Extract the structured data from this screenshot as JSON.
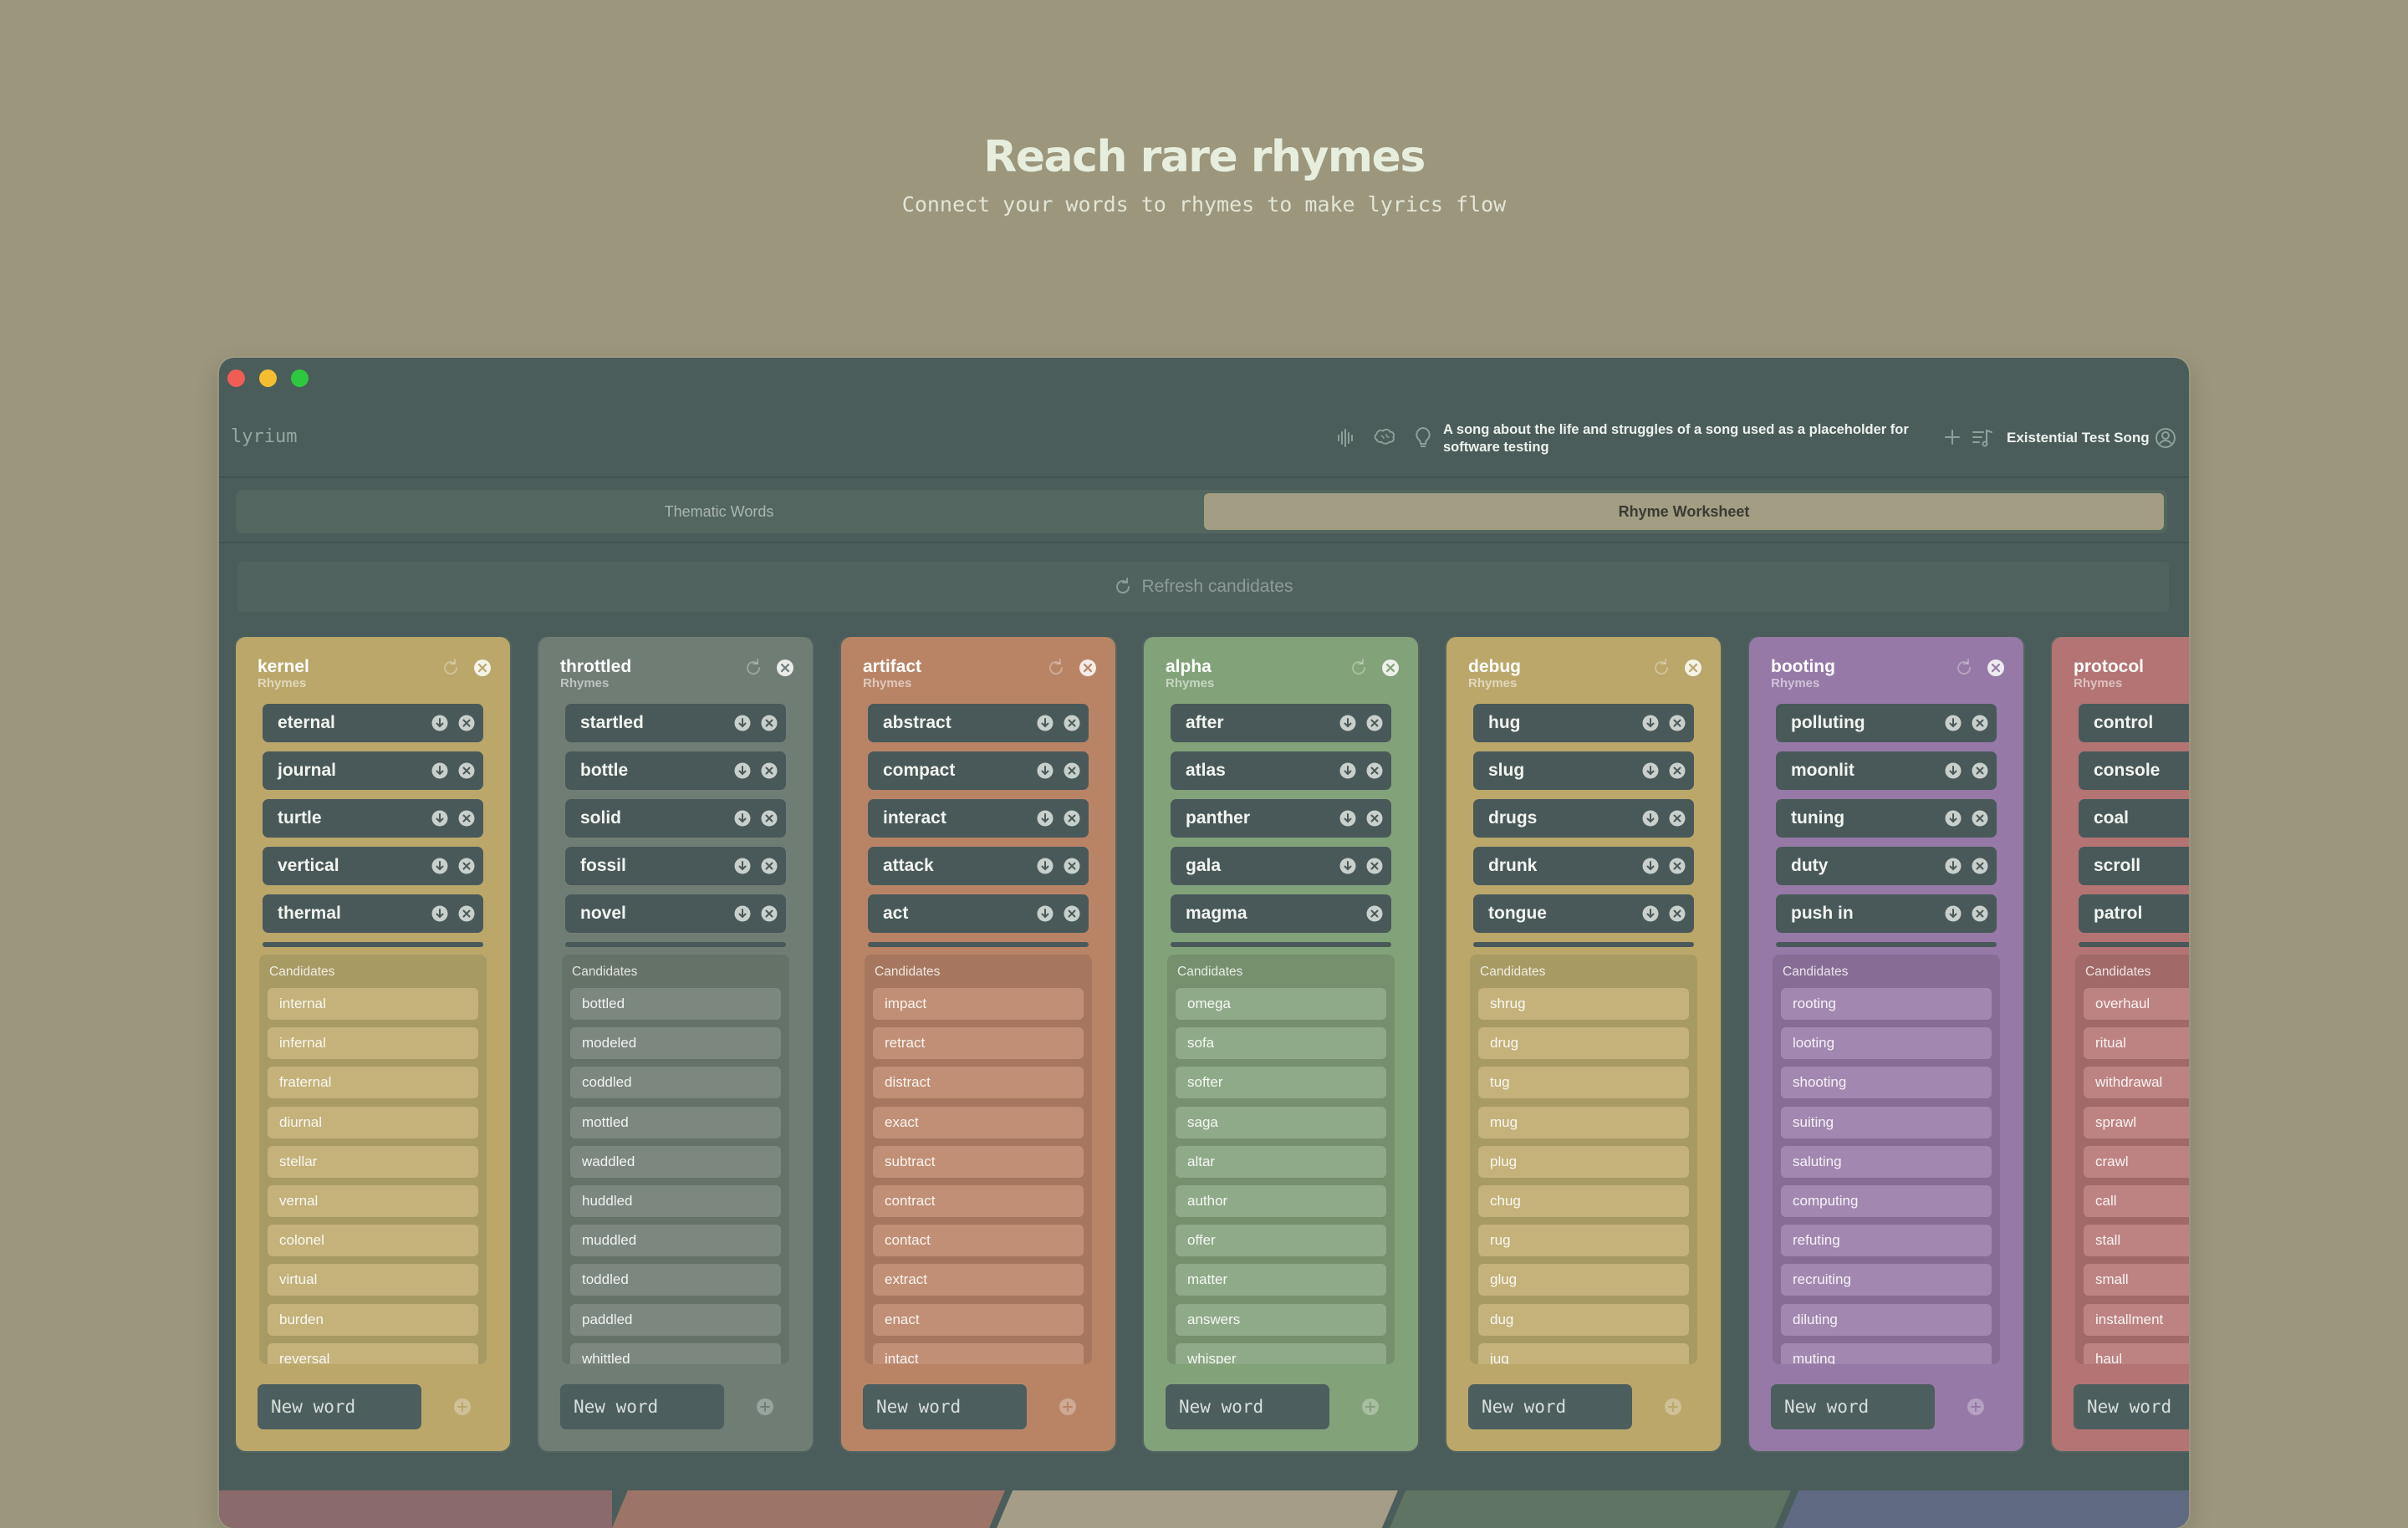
{
  "hero": {
    "title": "Reach rare rhymes",
    "subtitle": "Connect your words to rhymes to make lyrics flow"
  },
  "app": {
    "logo": "lyrium",
    "header_icons": [
      "waveform-icon",
      "brain-icon",
      "lightbulb-icon"
    ],
    "song_description": "A song about the life and struggles of a song used as a placeholder for software testing",
    "song_title": "Existential Test Song"
  },
  "tabs": [
    {
      "label": "Thematic Words",
      "active": false
    },
    {
      "label": "Rhyme Worksheet",
      "active": true
    }
  ],
  "refresh_label": "Refresh candidates",
  "new_word_placeholder": "New word",
  "colors": {
    "kernel": "#bba76a",
    "throttled": "#6f7d75",
    "artifact": "#b98466",
    "alpha": "#82a279",
    "debug": "#bba76a",
    "booting": "#9679a6",
    "protocol": "#b37473"
  },
  "columns": [
    {
      "key": "kernel",
      "title": "kernel",
      "subtitle": "Rhymes",
      "bg": "#bba76a",
      "panel": "#a89a63",
      "cand_bg": "#c4b27a",
      "rhymes": [
        "eternal",
        "journal",
        "turtle",
        "vertical",
        "thermal"
      ],
      "candidates": [
        "internal",
        "infernal",
        "fraternal",
        "diurnal",
        "stellar",
        "vernal",
        "colonel",
        "virtual",
        "burden",
        "reversal"
      ]
    },
    {
      "key": "throttled",
      "title": "throttled",
      "subtitle": "Rhymes",
      "bg": "#6f7d75",
      "panel": "#657268",
      "cand_bg": "#7b877f",
      "rhymes": [
        "startled",
        "bottle",
        "solid",
        "fossil",
        "novel"
      ],
      "candidates": [
        "bottled",
        "modeled",
        "coddled",
        "mottled",
        "waddled",
        "huddled",
        "muddled",
        "toddled",
        "paddled",
        "whittled"
      ]
    },
    {
      "key": "artifact",
      "title": "artifact",
      "subtitle": "Rhymes",
      "bg": "#b98466",
      "panel": "#a6775e",
      "cand_bg": "#c18f75",
      "rhymes": [
        "abstract",
        "compact",
        "interact",
        "attack",
        "act"
      ],
      "candidates": [
        "impact",
        "retract",
        "distract",
        "exact",
        "subtract",
        "contract",
        "contact",
        "extract",
        "enact",
        "intact"
      ]
    },
    {
      "key": "alpha",
      "title": "alpha",
      "subtitle": "Rhymes",
      "bg": "#82a279",
      "panel": "#76906d",
      "cand_bg": "#8faa88",
      "rhymes": [
        "after",
        "atlas",
        "panther",
        "gala",
        "magma"
      ],
      "candidates": [
        "omega",
        "sofa",
        "softer",
        "saga",
        "altar",
        "author",
        "offer",
        "matter",
        "answers",
        "whisper"
      ]
    },
    {
      "key": "debug",
      "title": "debug",
      "subtitle": "Rhymes",
      "bg": "#bba76a",
      "panel": "#a89a63",
      "cand_bg": "#c4b27a",
      "rhymes": [
        "hug",
        "slug",
        "drugs",
        "drunk",
        "tongue"
      ],
      "candidates": [
        "shrug",
        "drug",
        "tug",
        "mug",
        "plug",
        "chug",
        "rug",
        "glug",
        "dug",
        "jug"
      ]
    },
    {
      "key": "booting",
      "title": "booting",
      "subtitle": "Rhymes",
      "bg": "#9679a6",
      "panel": "#876d96",
      "cand_bg": "#a287b0",
      "rhymes": [
        "polluting",
        "moonlit",
        "tuning",
        "duty",
        "push in"
      ],
      "candidates": [
        "rooting",
        "looting",
        "shooting",
        "suiting",
        "saluting",
        "computing",
        "refuting",
        "recruiting",
        "diluting",
        "muting"
      ]
    },
    {
      "key": "protocol",
      "title": "protocol",
      "subtitle": "Rhymes",
      "bg": "#b37473",
      "panel": "#a16968",
      "cand_bg": "#bd8382",
      "rhymes": [
        "control",
        "console",
        "coal",
        "scroll",
        "patrol"
      ],
      "candidates": [
        "overhaul",
        "ritual",
        "withdrawal",
        "sprawl",
        "crawl",
        "call",
        "stall",
        "small",
        "installment",
        "haul"
      ]
    }
  ]
}
